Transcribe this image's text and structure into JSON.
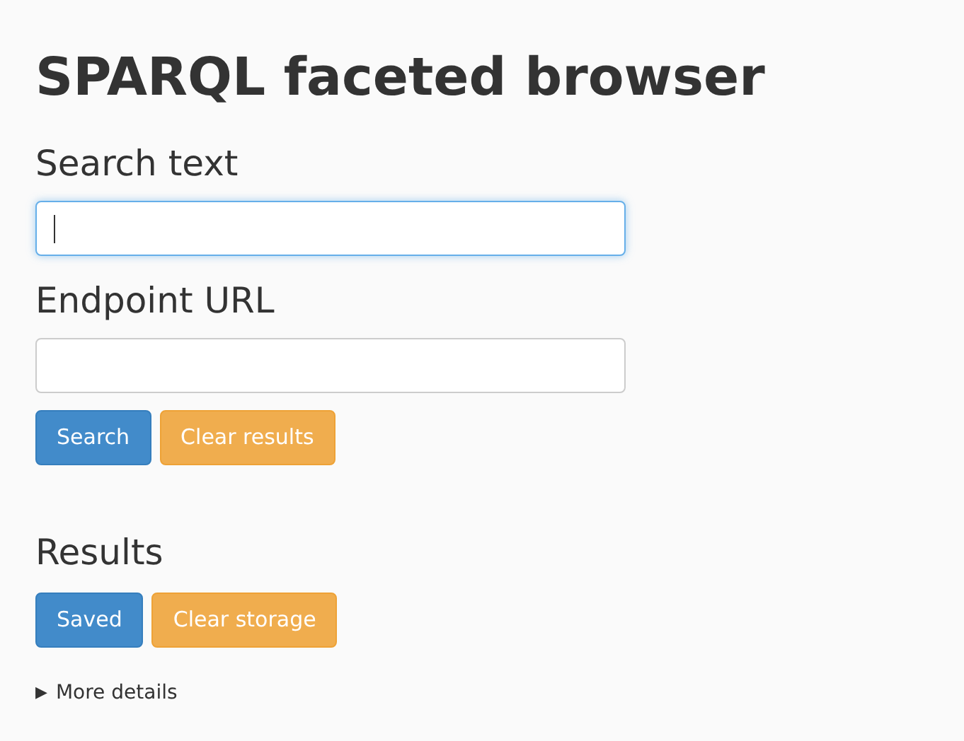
{
  "title": "SPARQL faceted browser",
  "fields": [
    {
      "label": "Search text",
      "focused": true
    },
    {
      "label": "Endpoint URL",
      "focused": false
    }
  ],
  "search_buttons": [
    {
      "label": "Search",
      "kind": "primary"
    },
    {
      "label": "Clear results",
      "kind": "warning"
    }
  ],
  "results": {
    "heading": "Results",
    "buttons": [
      {
        "label": "Saved",
        "kind": "primary"
      },
      {
        "label": "Clear storage",
        "kind": "warning"
      }
    ]
  },
  "details": {
    "marker": "▶",
    "label": "More details",
    "expanded": false
  }
}
